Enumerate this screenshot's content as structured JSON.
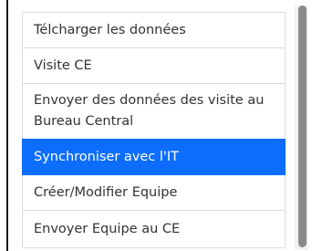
{
  "menu": {
    "items": [
      {
        "label": "Télcharger les données"
      },
      {
        "label": "Visite CE"
      },
      {
        "label": "Envoyer des données des visite au Bureau Central"
      },
      {
        "label": "Synchroniser avec l'IT",
        "active": true
      },
      {
        "label": "Créer/Modifier Equipe"
      },
      {
        "label": "Envoyer Equipe au CE"
      }
    ]
  },
  "colors": {
    "active_background": "#0d6efd",
    "active_text": "#ffffff",
    "item_text": "#333333",
    "item_border": "#dcdcdc",
    "scrollbar_thumb": "#8a8a8a"
  }
}
